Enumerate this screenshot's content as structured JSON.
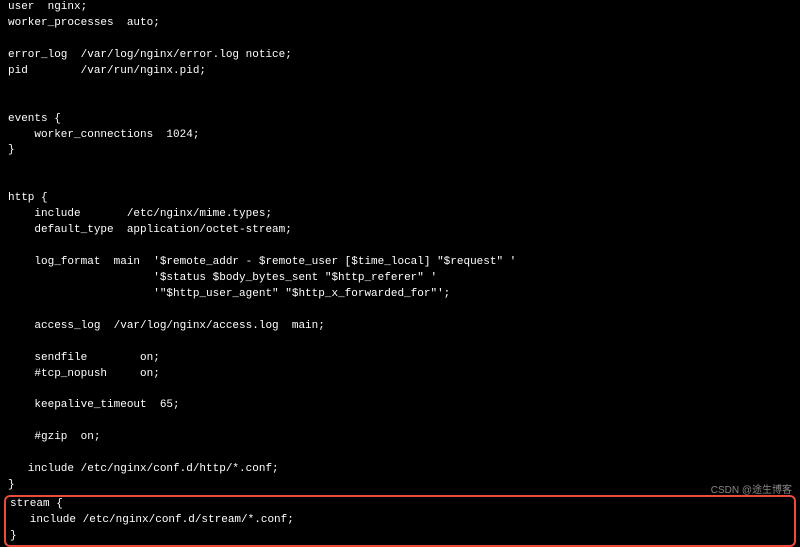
{
  "config": {
    "main_block": "user  nginx;\nworker_processes  auto;\n\nerror_log  /var/log/nginx/error.log notice;\npid        /var/run/nginx.pid;\n\n\nevents {\n    worker_connections  1024;\n}\n\n\nhttp {\n    include       /etc/nginx/mime.types;\n    default_type  application/octet-stream;\n\n    log_format  main  '$remote_addr - $remote_user [$time_local] \"$request\" '\n                      '$status $body_bytes_sent \"$http_referer\" '\n                      '\"$http_user_agent\" \"$http_x_forwarded_for\"';\n\n    access_log  /var/log/nginx/access.log  main;\n\n    sendfile        on;\n    #tcp_nopush     on;\n\n    keepalive_timeout  65;\n\n    #gzip  on;\n\n   include /etc/nginx/conf.d/http/*.conf;\n}\n",
    "stream_block": "stream {\n   include /etc/nginx/conf.d/stream/*.conf;\n}"
  },
  "watermark": "CSDN @途生博客"
}
